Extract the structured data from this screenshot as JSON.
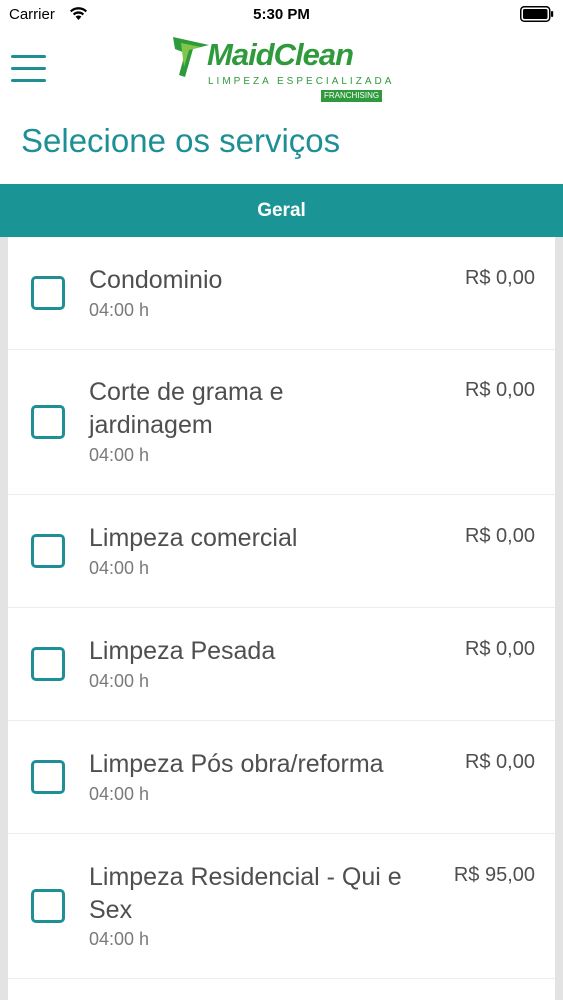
{
  "status_bar": {
    "carrier": "Carrier",
    "time": "5:30 PM",
    "wifi_icon": "wifi-icon",
    "battery_icon": "battery-full-icon"
  },
  "header": {
    "menu_icon": "hamburger-menu-icon",
    "logo": {
      "name": "MaidClean",
      "tagline": "LIMPEZA ESPECIALIZADA",
      "badge": "FRANCHISING"
    }
  },
  "page": {
    "title": "Selecione os serviços"
  },
  "section": {
    "label": "Geral"
  },
  "services": [
    {
      "name": "Condominio",
      "duration": "04:00 h",
      "price": "R$ 0,00",
      "checked": false
    },
    {
      "name": "Corte de grama e jardinagem",
      "duration": "04:00 h",
      "price": "R$ 0,00",
      "checked": false
    },
    {
      "name": "Limpeza comercial",
      "duration": "04:00 h",
      "price": "R$ 0,00",
      "checked": false
    },
    {
      "name": "Limpeza Pesada",
      "duration": "04:00 h",
      "price": "R$ 0,00",
      "checked": false
    },
    {
      "name": "Limpeza Pós obra/reforma",
      "duration": "04:00 h",
      "price": "R$ 0,00",
      "checked": false
    },
    {
      "name": "Limpeza Residencial - Qui e Sex",
      "duration": "04:00 h",
      "price": "R$ 95,00",
      "checked": false
    }
  ],
  "colors": {
    "accent": "#1e8f94",
    "section_bar": "#1a9495",
    "logo_green": "#2e9a3c"
  }
}
